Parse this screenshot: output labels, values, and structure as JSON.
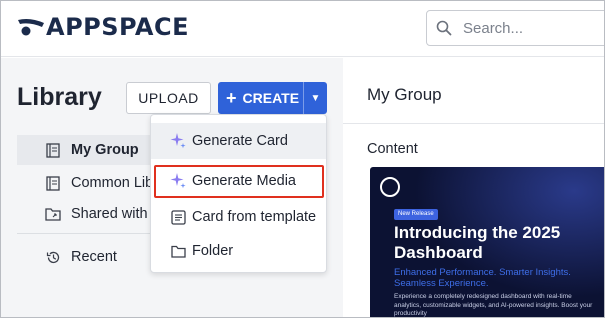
{
  "brand": {
    "name": "APPSPACE",
    "color": "#1b2b4b",
    "icon": "appspace-logo-icon"
  },
  "search": {
    "placeholder": "Search...",
    "icon": "search-icon"
  },
  "library": {
    "title": "Library",
    "upload_label": "UPLOAD",
    "create_label": "CREATE",
    "create_color": "#2f62d9"
  },
  "sidebar": {
    "items": [
      {
        "label": "My Group",
        "icon": "book-icon",
        "active": true
      },
      {
        "label": "Common Lib",
        "icon": "book-icon",
        "active": false
      },
      {
        "label": "Shared with",
        "icon": "shared-folder-icon",
        "active": false
      },
      {
        "label": "Recent",
        "icon": "history-icon",
        "active": false
      }
    ]
  },
  "create_menu": {
    "items": [
      {
        "label": "Generate Card",
        "icon": "sparkle-icon"
      },
      {
        "label": "Generate Media",
        "icon": "sparkle-icon",
        "highlighted": true
      },
      {
        "label": "Card from template",
        "icon": "template-icon"
      },
      {
        "label": "Folder",
        "icon": "folder-icon"
      }
    ],
    "highlight_color": "#e0301e"
  },
  "main": {
    "title": "My Group",
    "content_label": "Content",
    "card": {
      "tag": "New Release",
      "headline": "Introducing the 2025 Dashboard",
      "subheadline": "Enhanced Performance. Smarter Insights. Seamless Experience.",
      "description": "Experience a completely redesigned dashboard with real-time analytics, customizable widgets, and AI-powered insights. Boost your productivity"
    }
  }
}
